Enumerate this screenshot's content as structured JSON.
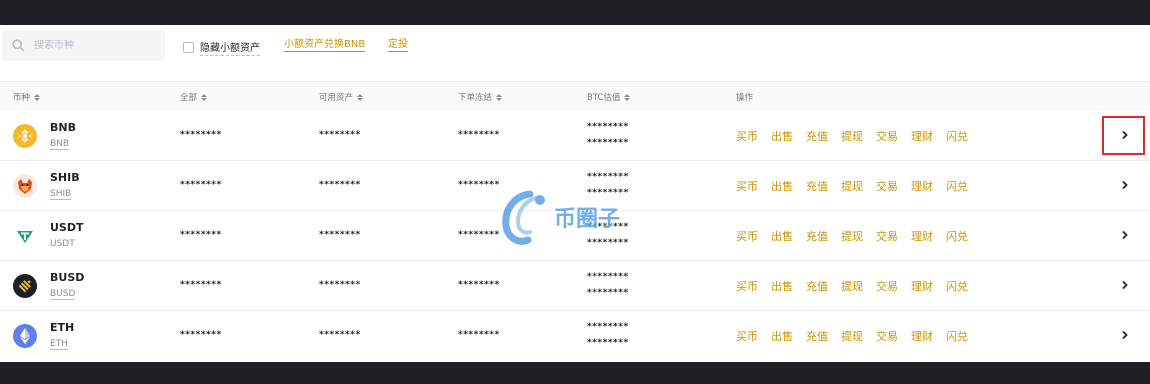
{
  "toolbar": {
    "search_placeholder": "搜索币种",
    "hide_small_label": "隐藏小额资产",
    "convert_small_label": "小额资产兑换BNB",
    "dca_label": "定投"
  },
  "table": {
    "headers": [
      "币种",
      "全部",
      "可用资产",
      "下单冻结",
      "BTC估值",
      "操作"
    ],
    "actions": [
      "买币",
      "出售",
      "充值",
      "提现",
      "交易",
      "理财",
      "闪兑"
    ],
    "rows": [
      {
        "symbol": "BNB",
        "name": "BNB",
        "total": "********",
        "available": "********",
        "frozen": "********",
        "btc1": "********",
        "btc2": "********",
        "icon": "bnb-icon",
        "color": "#f3ba2f"
      },
      {
        "symbol": "SHIB",
        "name": "SHIB",
        "total": "********",
        "available": "********",
        "frozen": "********",
        "btc1": "********",
        "btc2": "********",
        "icon": "shib-icon",
        "color": "#e44d1d"
      },
      {
        "symbol": "USDT",
        "name": "USDT",
        "total": "********",
        "available": "********",
        "frozen": "********",
        "btc1": "********",
        "btc2": "********",
        "icon": "usdt-icon",
        "color": "#26a17b"
      },
      {
        "symbol": "BUSD",
        "name": "BUSD",
        "total": "********",
        "available": "********",
        "frozen": "********",
        "btc1": "********",
        "btc2": "********",
        "icon": "busd-icon",
        "color": "#1e2026"
      },
      {
        "symbol": "ETH",
        "name": "ETH",
        "total": "********",
        "available": "********",
        "frozen": "********",
        "btc1": "********",
        "btc2": "********",
        "icon": "eth-icon",
        "color": "#627eea"
      }
    ]
  },
  "watermark": {
    "text": "币圈子"
  },
  "colors": {
    "accent": "#c99400",
    "highlight": "#d92d2d",
    "frame": "#1e2026"
  }
}
